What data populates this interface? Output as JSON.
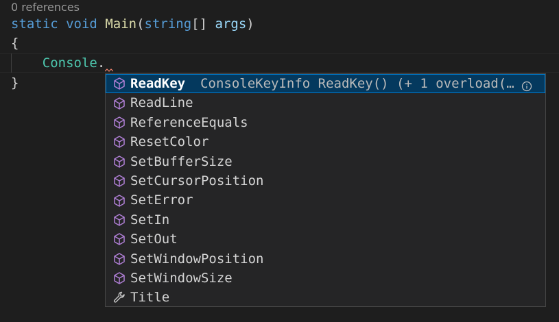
{
  "codelens": "0 references",
  "code": {
    "line1": {
      "kw1": "static",
      "kw2": "void",
      "fn": "Main",
      "open": "(",
      "type": "string",
      "brackets": "[]",
      "param": "args",
      "close": ")"
    },
    "line2": "{",
    "line3": {
      "indent": "    ",
      "type": "Console",
      "dot": "."
    },
    "line4": "}"
  },
  "suggest": {
    "items": [
      {
        "label": "ReadKey",
        "icon": "method-icon",
        "detail": "ConsoleKeyInfo ReadKey() (+ 1 overload(…",
        "selected": true
      },
      {
        "label": "ReadLine",
        "icon": "method-icon"
      },
      {
        "label": "ReferenceEquals",
        "icon": "method-icon"
      },
      {
        "label": "ResetColor",
        "icon": "method-icon"
      },
      {
        "label": "SetBufferSize",
        "icon": "method-icon"
      },
      {
        "label": "SetCursorPosition",
        "icon": "method-icon"
      },
      {
        "label": "SetError",
        "icon": "method-icon"
      },
      {
        "label": "SetIn",
        "icon": "method-icon"
      },
      {
        "label": "SetOut",
        "icon": "method-icon"
      },
      {
        "label": "SetWindowPosition",
        "icon": "method-icon"
      },
      {
        "label": "SetWindowSize",
        "icon": "method-icon"
      },
      {
        "label": "Title",
        "icon": "property-wrench-icon"
      }
    ]
  },
  "colors": {
    "background": "#1e1e1e",
    "method_icon": "#b180d7",
    "selection_bg": "#04395e",
    "selection_border": "#007fd4",
    "squiggle": "#f48771"
  }
}
